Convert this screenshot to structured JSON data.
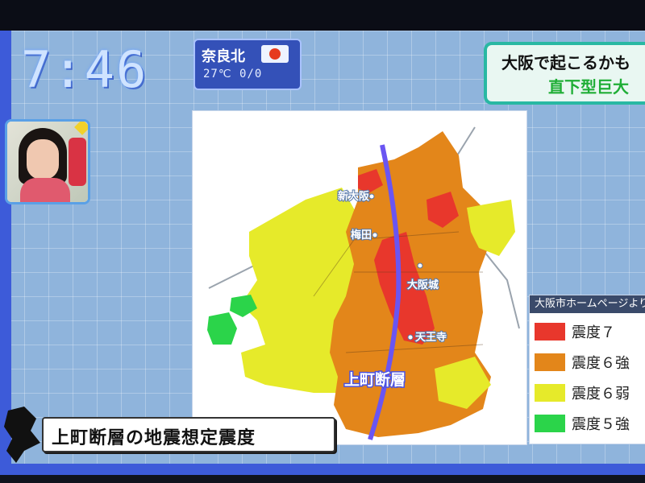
{
  "clock": {
    "time": "7:46"
  },
  "weather": {
    "city": "奈良北",
    "icon": "sun-icon",
    "stats": "27℃ 0/0"
  },
  "headline": {
    "line1": "大阪で起こるかも",
    "line2": "直下型巨大"
  },
  "map": {
    "station_labels": [
      "新大阪",
      "梅田",
      "大阪城",
      "天王寺"
    ],
    "fault_label": "上町断層",
    "colors": {
      "shindo7": "#e8372c",
      "shindo6strong": "#e3861a",
      "shindo6weak": "#e6ea2a",
      "shindo5strong": "#2bd44a",
      "fault_line": "#6a55f2"
    }
  },
  "legend": {
    "title": "大阪市ホームページより",
    "items": [
      {
        "label": "震度７",
        "color": "#e8372c"
      },
      {
        "label": "震度６強",
        "color": "#e3861a"
      },
      {
        "label": "震度６弱",
        "color": "#e6ea2a"
      },
      {
        "label": "震度５強",
        "color": "#2bd44a"
      }
    ]
  },
  "caption": {
    "text": "上町断層の地震想定震度"
  }
}
